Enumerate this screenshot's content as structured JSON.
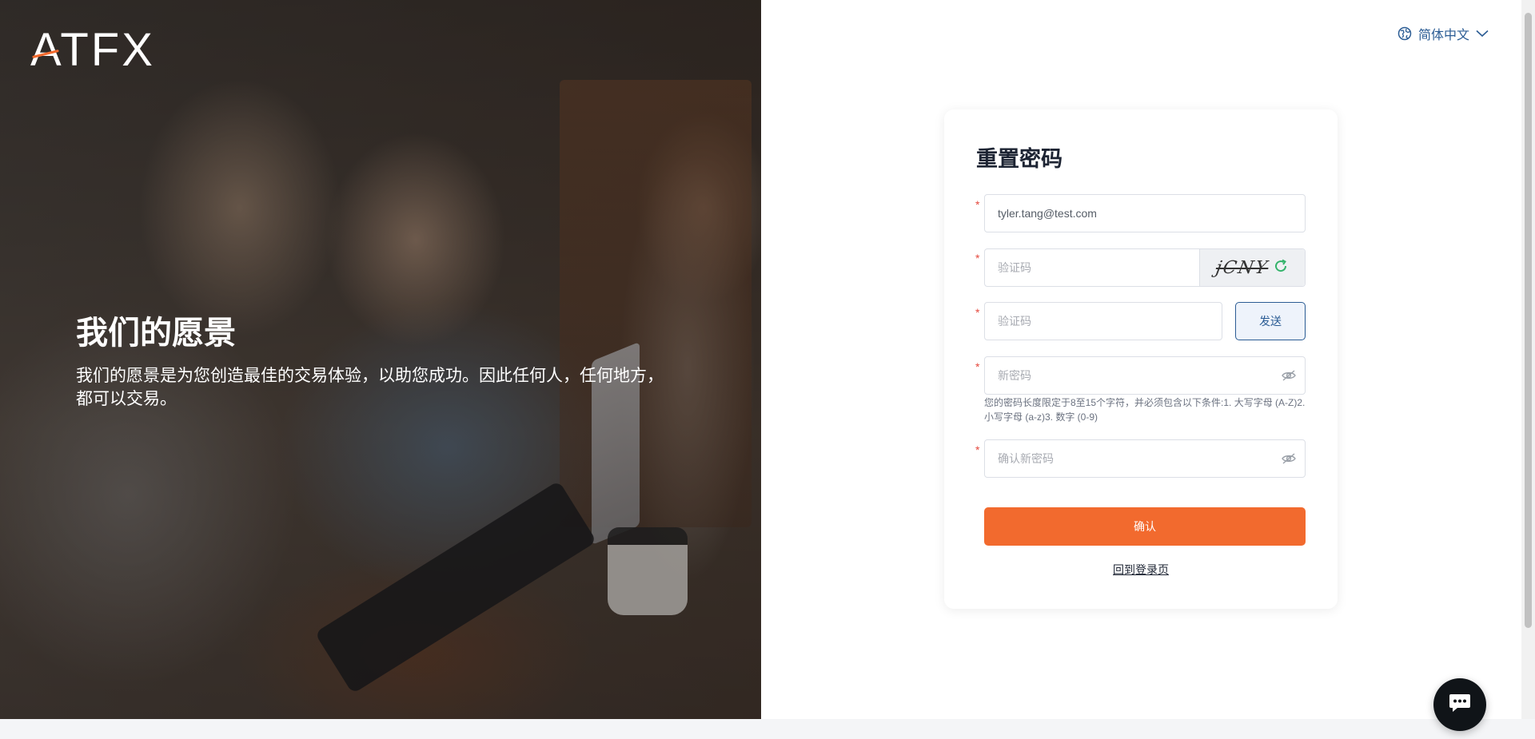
{
  "brand": {
    "logo_text": "ATFX",
    "accent_color": "#f26a2e",
    "primary_color": "#2b5c94"
  },
  "hero": {
    "title": "我们的愿景",
    "description": "我们的愿景是为您创造最佳的交易体验，以助您成功。因此任何人，任何地方，都可以交易。"
  },
  "language": {
    "icon": "globe-icon",
    "current": "简体中文",
    "chevron": "chevron-down-icon"
  },
  "form": {
    "title": "重置密码",
    "required_mark": "*",
    "email": {
      "value": "tyler.tang@test.com"
    },
    "captcha": {
      "placeholder": "验证码",
      "image_text": "jCNY",
      "refresh_icon": "refresh-icon"
    },
    "verification_code": {
      "placeholder": "验证码",
      "send_label": "发送"
    },
    "new_password": {
      "placeholder": "新密码",
      "toggle_icon": "eye-off-icon",
      "hint": "您的密码长度限定于8至15个字符，并必须包含以下条件:1. 大写字母 (A-Z)2. 小写字母 (a-z)3. 数字 (0-9)"
    },
    "confirm_password": {
      "placeholder": "确认新密码",
      "toggle_icon": "eye-off-icon"
    },
    "submit_label": "确认",
    "back_link": "回到登录页"
  },
  "chat": {
    "icon": "chat-bubble-icon"
  }
}
